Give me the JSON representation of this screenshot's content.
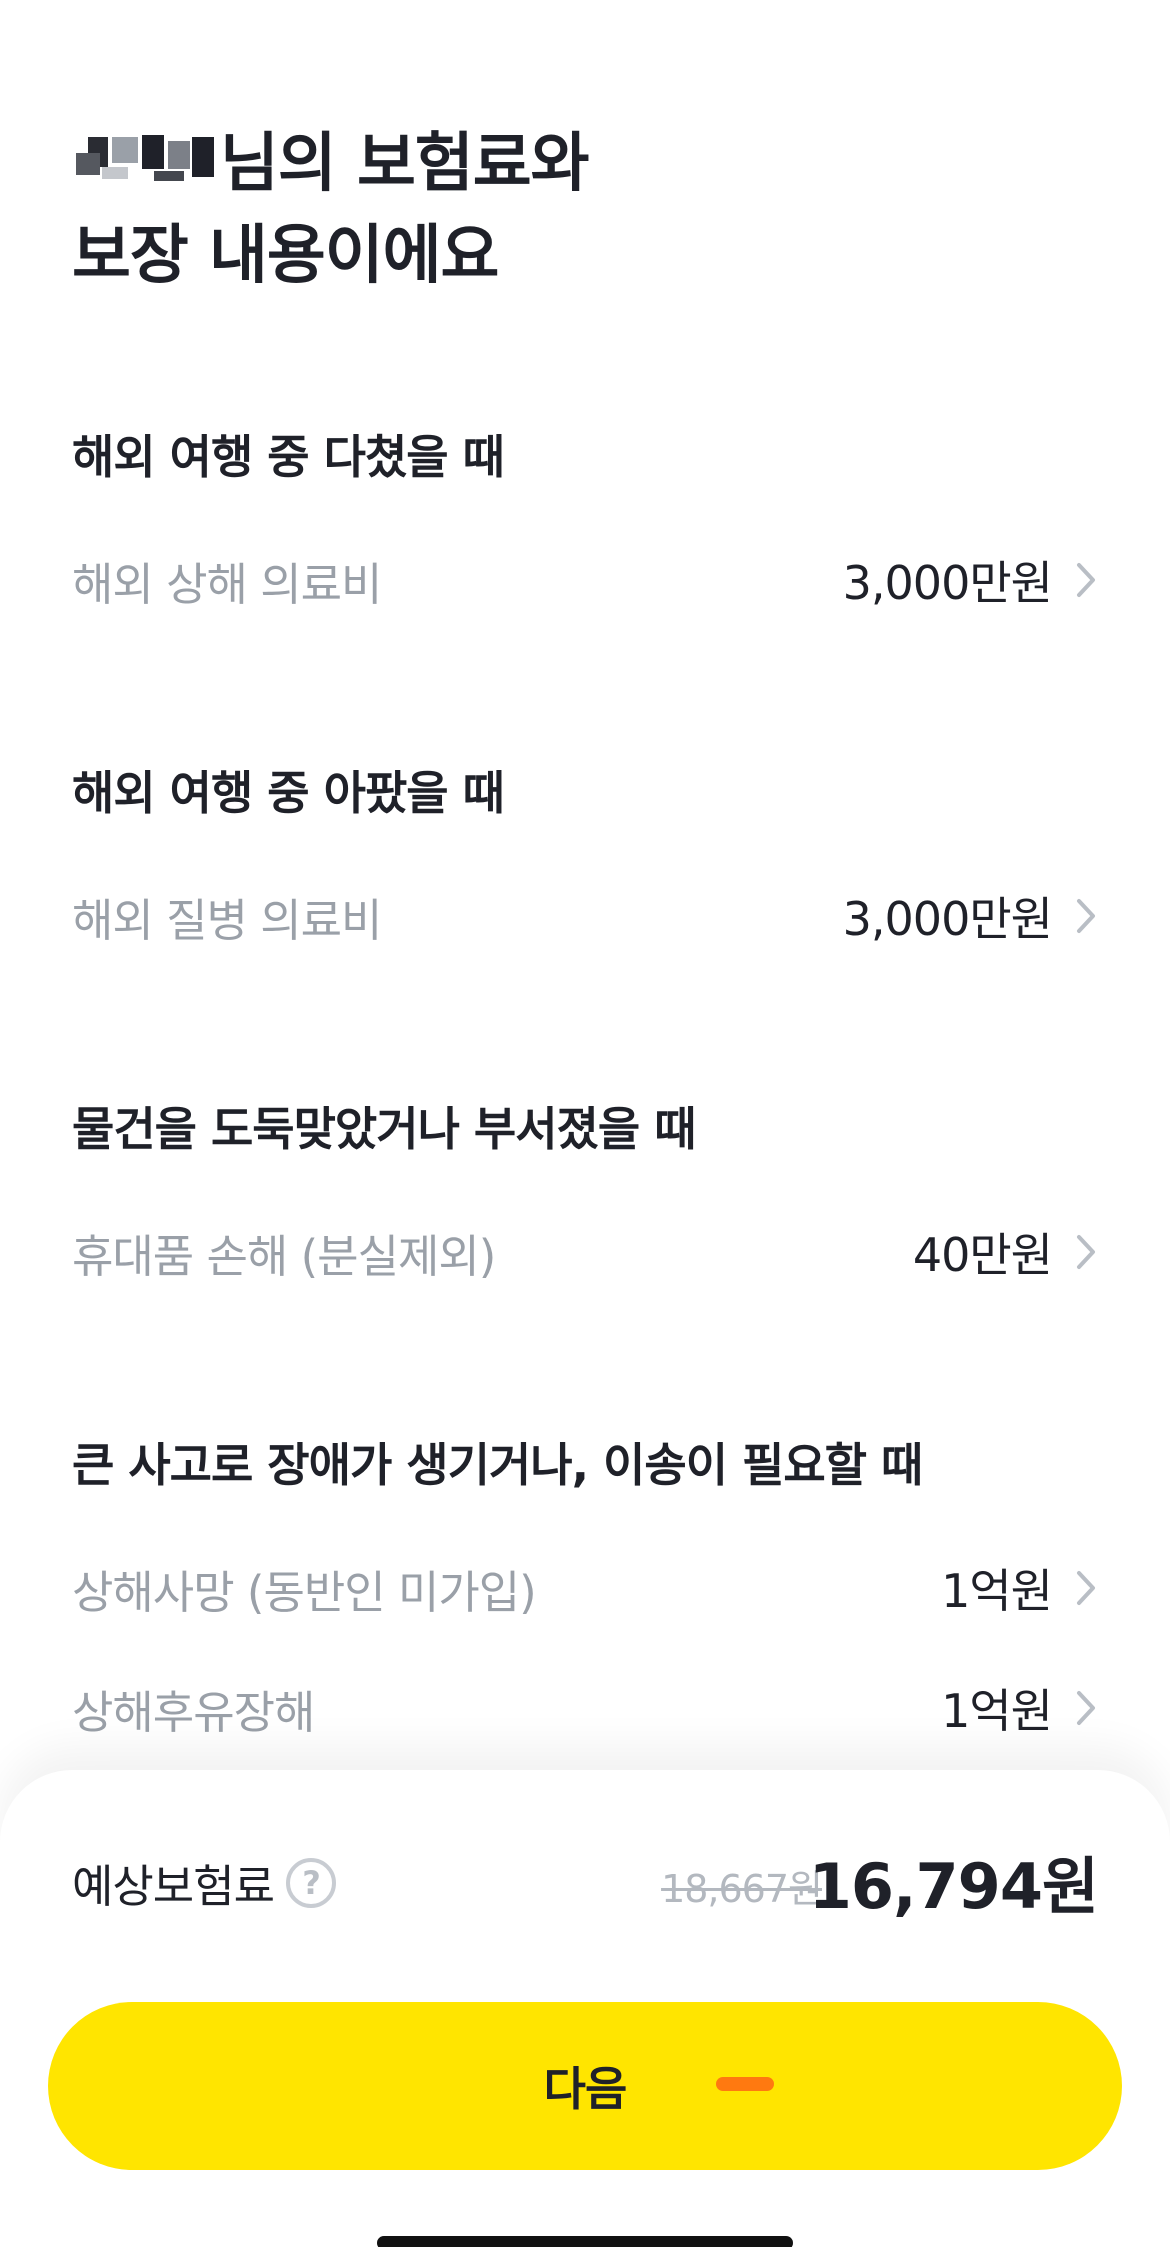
{
  "header": {
    "title_line1_suffix": "님의 보험료와",
    "title_line2": "보장 내용이에요"
  },
  "sections": [
    {
      "heading": "해외 여행 중 다쳤을 때",
      "rows": [
        {
          "label": "해외 상해 의료비",
          "value": "3,000만원"
        }
      ]
    },
    {
      "heading": "해외 여행 중 아팠을 때",
      "rows": [
        {
          "label": "해외 질병 의료비",
          "value": "3,000만원"
        }
      ]
    },
    {
      "heading": "물건을 도둑맞았거나 부서졌을 때",
      "rows": [
        {
          "label": "휴대품 손해 (분실제외)",
          "value": "40만원"
        }
      ]
    },
    {
      "heading": "큰 사고로 장애가 생기거나, 이송이 필요할 때",
      "rows": [
        {
          "label": "상해사망 (동반인 미가입)",
          "value": "1억원"
        },
        {
          "label": "상해후유장해",
          "value": "1억원"
        }
      ]
    }
  ],
  "premium": {
    "label": "예상보험료",
    "help_icon_glyph": "?",
    "original_price": "18,667원",
    "final_price": "16,794원"
  },
  "next_button": {
    "label": "다음"
  },
  "icons": {
    "chevron": "chevron-right-icon",
    "help": "question-circle-icon"
  },
  "colors": {
    "primary_button": "#ffe500",
    "text_primary": "#1f2129",
    "text_secondary": "#9aa0a8"
  }
}
